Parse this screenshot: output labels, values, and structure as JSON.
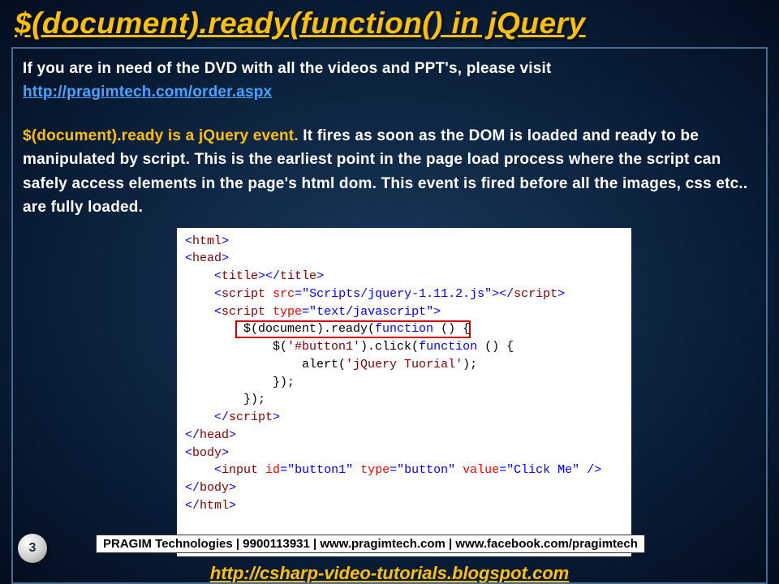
{
  "title": "$(document).ready(function() in jQuery",
  "intro": {
    "line1": "If you are in need of the DVD with all the videos and PPT's, please visit",
    "link": "http://pragimtech.com/order.aspx"
  },
  "definition": {
    "highlight": "$(document).ready is a jQuery event.",
    "rest": " It fires as soon as the DOM is loaded and ready to be manipulated by script. This is the earliest point in the page load process where the script can safely access elements in the page's html dom. This event is fired before all the images, css etc.. are fully loaded."
  },
  "code": {
    "l01a": "<",
    "l01b": "html",
    "l01c": ">",
    "l02a": "<",
    "l02b": "head",
    "l02c": ">",
    "l03a": "    <",
    "l03b": "title",
    "l03c": "></",
    "l03d": "title",
    "l03e": ">",
    "l04a": "    <",
    "l04b": "script",
    "l04c": " ",
    "l04d": "src",
    "l04e": "=\"Scripts/jquery-1.11.2.js\"",
    "l04f": "></",
    "l04g": "script",
    "l04h": ">",
    "l05a": "    <",
    "l05b": "script",
    "l05c": " ",
    "l05d": "type",
    "l05e": "=\"text/javascript\"",
    "l05f": ">",
    "l06a": "        $(document).ready(",
    "l06b": "function",
    "l06c": " () {",
    "l07a": "            $(",
    "l07b": "'#button1'",
    "l07c": ").click(",
    "l07d": "function",
    "l07e": " () {",
    "l08a": "                alert(",
    "l08b": "'jQuery Tuorial'",
    "l08c": ");",
    "l09": "            });",
    "l10": "        });",
    "l11a": "    </",
    "l11b": "script",
    "l11c": ">",
    "l12a": "</",
    "l12b": "head",
    "l12c": ">",
    "l13a": "<",
    "l13b": "body",
    "l13c": ">",
    "l14a": "    <",
    "l14b": "input",
    "l14c": " ",
    "l14d": "id",
    "l14e": "=\"button1\"",
    "l14f": " ",
    "l14g": "type",
    "l14h": "=\"button\"",
    "l14i": " ",
    "l14j": "value",
    "l14k": "=\"Click Me\"",
    "l14l": " />",
    "l15a": "</",
    "l15b": "body",
    "l15c": ">",
    "l16a": "</",
    "l16b": "html",
    "l16c": ">"
  },
  "footer": {
    "page": "3",
    "company": "PRAGIM Technologies | 9900113931 | www.pragimtech.com | www.facebook.com/pragimtech",
    "link": "http://csharp-video-tutorials.blogspot.com"
  }
}
